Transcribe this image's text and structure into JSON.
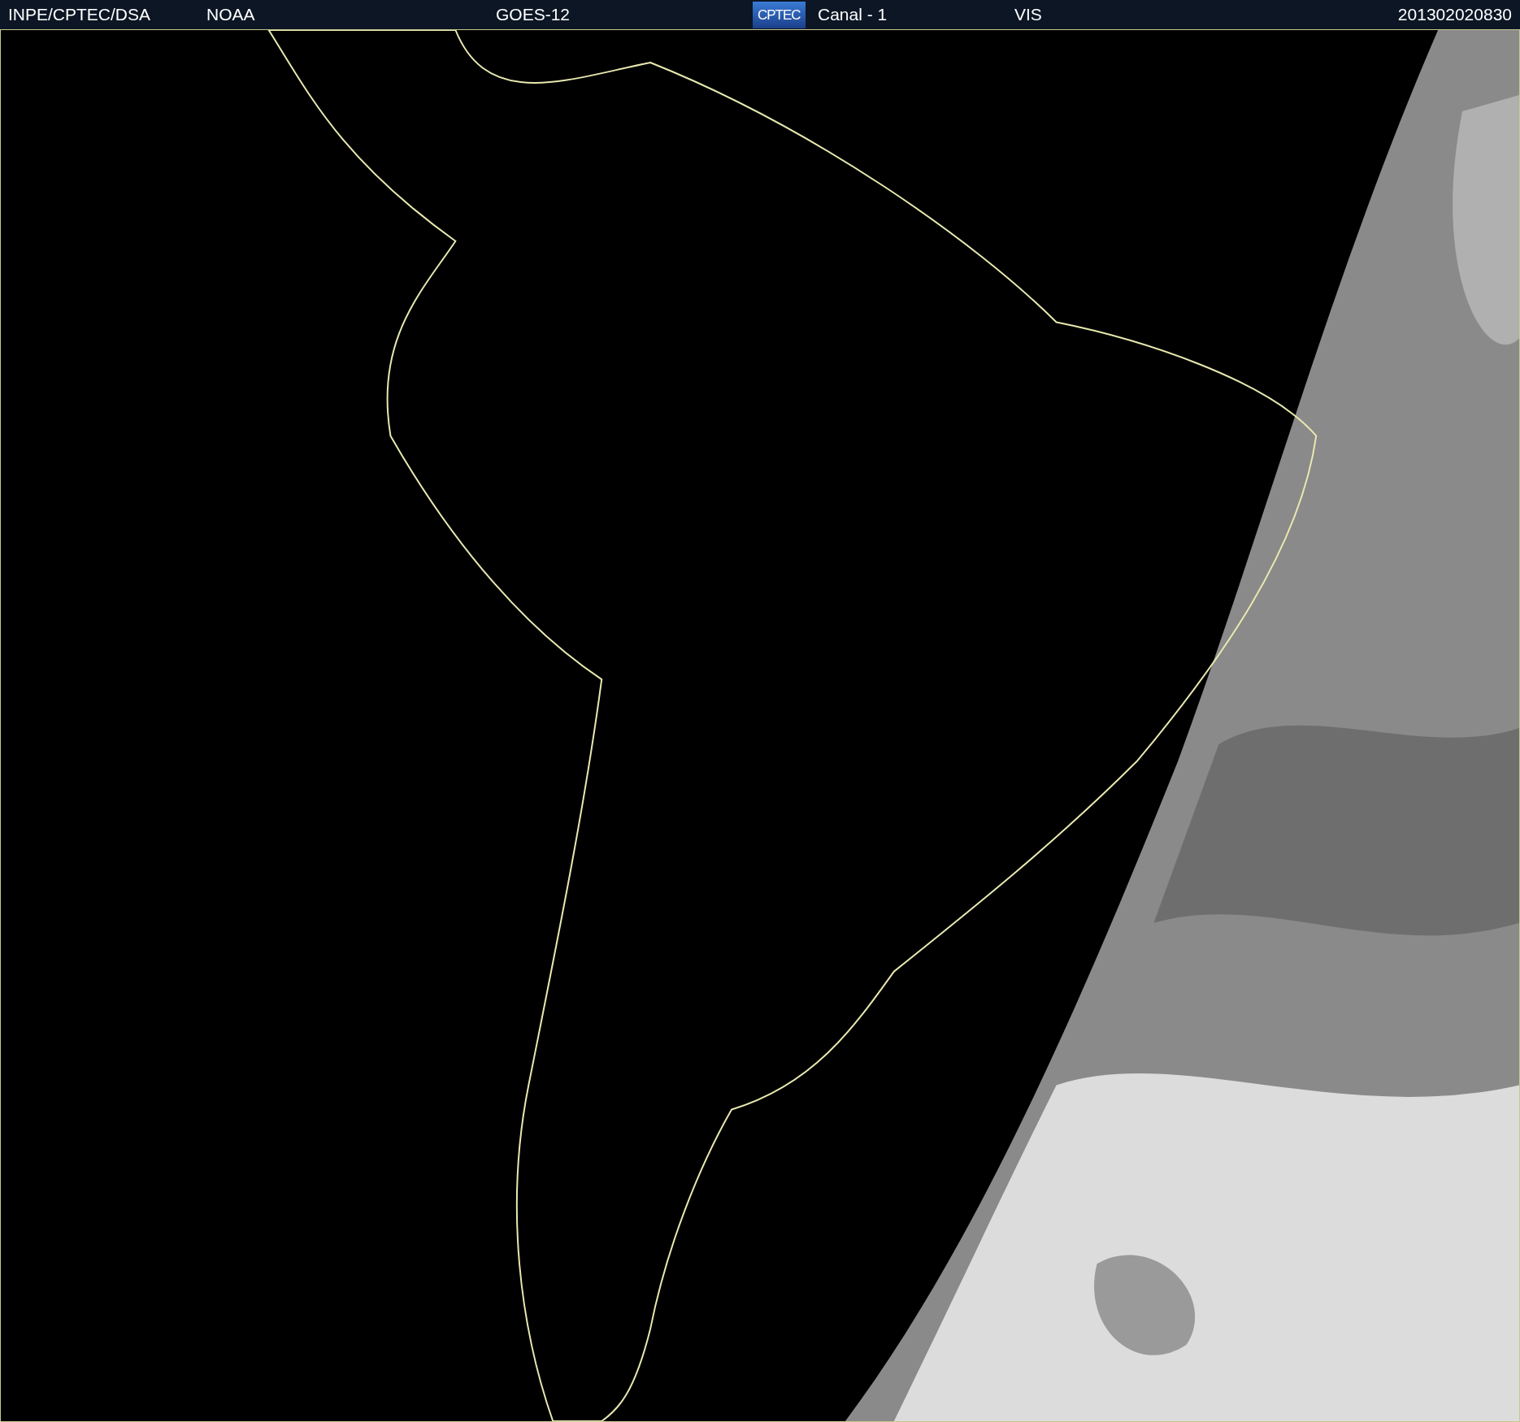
{
  "header": {
    "items": [
      {
        "kind": "text",
        "text": "INPE/CPTEC/DSA"
      },
      {
        "kind": "text",
        "text": "NOAA"
      },
      {
        "kind": "text",
        "text": "GOES-12"
      },
      {
        "kind": "logo",
        "text": "CPTEC"
      },
      {
        "kind": "text",
        "text": "Canal - 1"
      },
      {
        "kind": "text",
        "text": "VIS"
      },
      {
        "kind": "text",
        "text": "201302020830"
      }
    ]
  }
}
